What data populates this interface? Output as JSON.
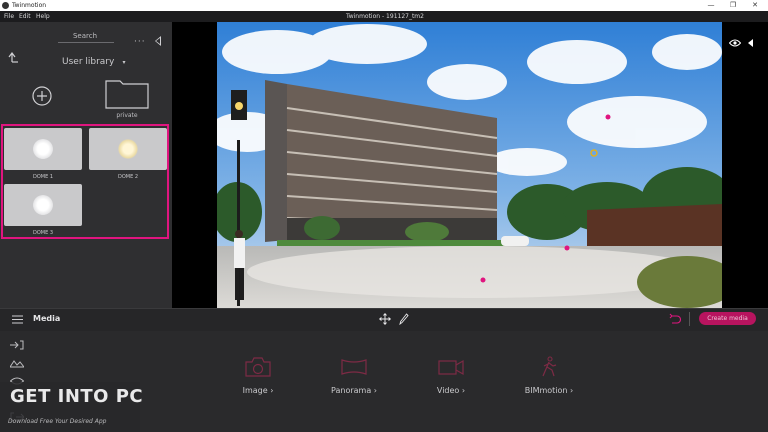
{
  "window": {
    "app_name": "Twinmotion",
    "doc_title": "Twinmotion - 191127_tm2",
    "min_symbol": "—",
    "max_symbol": "❐",
    "close_symbol": "✕"
  },
  "menu": {
    "items": [
      "File",
      "Edit",
      "Help"
    ]
  },
  "library": {
    "search_label": "Search",
    "selected": "User library",
    "folder_label": "private",
    "more": "···",
    "tiles": [
      {
        "label": "DOME 1",
        "glow": "#f4f4f6"
      },
      {
        "label": "DOME 2",
        "glow": "#f3e6b8"
      },
      {
        "label": "DOME 3",
        "glow": "#f4f4f6"
      }
    ]
  },
  "media": {
    "title": "Media",
    "create_button": "Create media",
    "options": [
      {
        "label": "Image",
        "icon": "camera-icon"
      },
      {
        "label": "Panorama",
        "icon": "panorama-icon"
      },
      {
        "label": "Video",
        "icon": "video-camera-icon"
      },
      {
        "label": "BIMmotion",
        "icon": "walking-person-icon"
      }
    ]
  },
  "colors": {
    "accent": "#e0157f",
    "accent_dark": "#b8145f",
    "icon_red": "#7d2a45"
  },
  "watermark": {
    "title": "GET INTO PC",
    "subtitle": "Download Free Your Desired App"
  }
}
